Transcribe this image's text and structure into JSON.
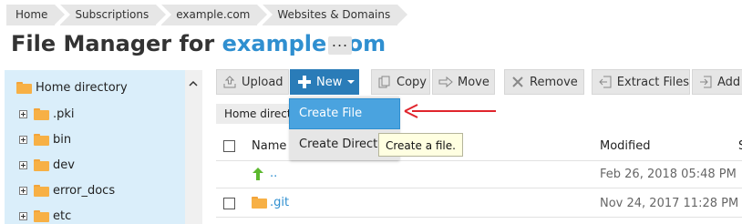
{
  "breadcrumb": [
    "Home",
    "Subscriptions",
    "example.com",
    "Websites & Domains"
  ],
  "title": {
    "prefix": "File Manager for ",
    "domain": "example.com",
    "more": "..."
  },
  "tree": {
    "root": "Home directory",
    "items": [
      ".pki",
      "bin",
      "dev",
      "error_docs",
      "etc"
    ]
  },
  "toolbar": {
    "upload": "Upload",
    "new": "New",
    "copy": "Copy",
    "move": "Move",
    "remove": "Remove",
    "extract": "Extract Files",
    "add": "Add"
  },
  "pathbar": "Home directory",
  "dropdown": {
    "create_file": "Create File",
    "create_directory": "Create Directory"
  },
  "tooltip": "Create a file.",
  "table": {
    "col_name": "Name",
    "col_modified": "Modified",
    "col_extra": "S",
    "rows": [
      {
        "name": "..",
        "modified": "Feb 26, 2018 05:48 PM"
      },
      {
        "name": ".git",
        "modified": "Nov 24, 2017 11:28 PM"
      }
    ]
  },
  "colors": {
    "accent": "#2a7cb8",
    "link": "#2f8fd0",
    "tree_bg": "#daeefa",
    "folder": "#f7b045",
    "annotation": "#e0242c"
  },
  "icons": [
    "upload-icon",
    "plus-icon",
    "copy-icon",
    "move-icon",
    "remove-icon",
    "extract-icon",
    "add-icon",
    "folder-icon",
    "up-arrow-icon",
    "expand-icon",
    "chevron-up-icon"
  ]
}
